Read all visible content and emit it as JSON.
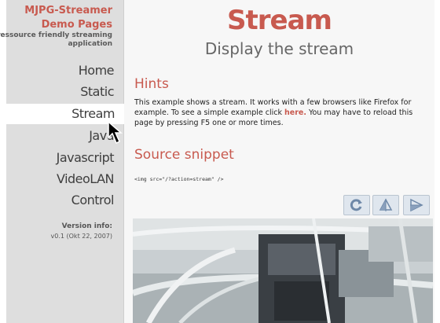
{
  "sidebar": {
    "brand_title": "MJPG-Streamer",
    "brand_subtitle": "Demo Pages",
    "tagline": "ressource friendly streaming application",
    "nav": [
      {
        "label": "Home"
      },
      {
        "label": "Static"
      },
      {
        "label": "Stream",
        "active": true
      },
      {
        "label": "Java"
      },
      {
        "label": "Javascript"
      },
      {
        "label": "VideoLAN"
      },
      {
        "label": "Control"
      }
    ],
    "version_label": "Version info:",
    "version_value": "v0.1 (Okt 22, 2007)"
  },
  "main": {
    "title": "Stream",
    "subtitle": "Display the stream",
    "hints_heading": "Hints",
    "hints_text_1": "This example shows a stream. It works with a few browsers like Firefox for example. To see a simple example click ",
    "hints_link": "here.",
    "hints_text_2": " You may have to reload this page by pressing F5 one or more times.",
    "snippet_heading": "Source snippet",
    "snippet_code": "<img src=\"/?action=stream\" />"
  },
  "toolbar": {
    "icons": [
      "rotate-icon",
      "flip-vertical-icon",
      "flip-horizontal-icon"
    ],
    "icon_color": "#6e88a8"
  },
  "colors": {
    "accent": "#c85a4f",
    "sidebar_bg": "#dedede",
    "content_bg": "#f7f7f7"
  }
}
